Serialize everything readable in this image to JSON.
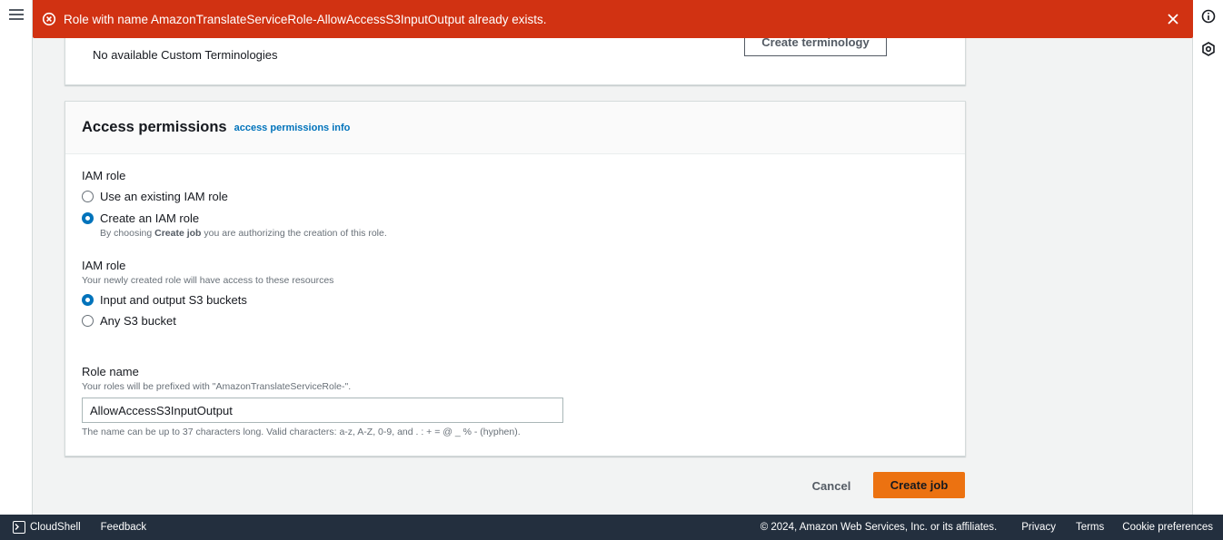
{
  "flash": {
    "message": "Role with name AmazonTranslateServiceRole-AllowAccessS3InputOutput already exists.",
    "type": "error",
    "color": "#d13212"
  },
  "terminology": {
    "empty_text": "No available Custom Terminologies",
    "create_button": "Create terminology"
  },
  "access": {
    "title": "Access permissions",
    "info_link": "access permissions info",
    "iam_role_label": "IAM role",
    "role_options": [
      {
        "label": "Use an existing IAM role",
        "checked": false
      },
      {
        "label": "Create an IAM role",
        "checked": true
      }
    ],
    "create_note_prefix": "By choosing ",
    "create_note_bold": "Create job",
    "create_note_suffix": " you are authorizing the creation of this role.",
    "scope_label": "IAM role",
    "scope_desc": "Your newly created role will have access to these resources",
    "scope_options": [
      {
        "label": "Input and output S3 buckets",
        "checked": true
      },
      {
        "label": "Any S3 bucket",
        "checked": false
      }
    ],
    "role_name_label": "Role name",
    "role_name_desc": "Your roles will be prefixed with \"AmazonTranslateServiceRole-\".",
    "role_name_value": "AllowAccessS3InputOutput",
    "role_name_constraint": "The name can be up to 37 characters long. Valid characters: a-z, A-Z, 0-9, and . : + = @ _ % - (hyphen)."
  },
  "actions": {
    "cancel": "Cancel",
    "create": "Create job",
    "primary_color": "#ec7211"
  },
  "footer": {
    "cloudshell": "CloudShell",
    "feedback": "Feedback",
    "copyright": "© 2024, Amazon Web Services, Inc. or its affiliates.",
    "privacy": "Privacy",
    "terms": "Terms",
    "cookies": "Cookie preferences"
  },
  "icons": {
    "menu": "hamburger-icon",
    "info": "info-icon",
    "settings": "hexagon-settings-icon",
    "error": "error-circle-icon",
    "close": "close-icon",
    "cloudshell": "terminal-icon"
  }
}
